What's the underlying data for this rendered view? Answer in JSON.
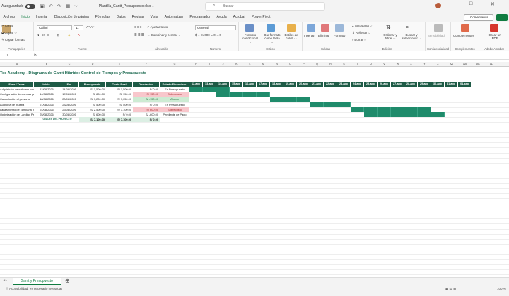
{
  "titlebar": {
    "autosave": "Autoguardado",
    "filename": "Plantilla_Gantt_Presupuesto.xlsx ⌵",
    "search_placeholder": "Buscar"
  },
  "menubar": {
    "tabs": [
      "Archivo",
      "Inicio",
      "Insertar",
      "Disposición de página",
      "Fórmulas",
      "Datos",
      "Revisar",
      "Vista",
      "Automatizar",
      "Programador",
      "Ayuda",
      "Acrobat",
      "Power Pivot"
    ],
    "active": 1,
    "comments": "Comentarios"
  },
  "ribbon": {
    "clipboard": {
      "cut": "Cortar",
      "copy": "Copiar ⌵",
      "paste_format": "Copiar formato",
      "label": "Portapapeles"
    },
    "font": {
      "name": "Calibri",
      "size": "11",
      "label": "Fuente"
    },
    "alignment": {
      "wrap": "Ajustar texto",
      "merge": "Combinar y centrar ⌵",
      "label": "Alineación"
    },
    "number": {
      "format": "General",
      "label": "Número"
    },
    "styles": {
      "cond": "Formato condicional ⌵",
      "table": "Dar formato como tabla ⌵",
      "cell": "Estilos de celda ⌵",
      "label": "Estilos"
    },
    "cells": {
      "insert": "Insertar",
      "delete": "Eliminar",
      "format": "Formato",
      "label": "Celdas"
    },
    "editing": {
      "autosum": "Autosuma ⌵",
      "fill": "Rellenar ⌵",
      "clear": "Borrar ⌵",
      "sort": "Ordenar y filtrar ⌵",
      "find": "Buscar y seleccionar ⌵",
      "label": "Edición"
    },
    "sensitivity": {
      "btn": "Sensibilidad",
      "label": "Confidencialidad"
    },
    "addins": {
      "btn": "Complementos",
      "label": "Complementos"
    },
    "pdf": {
      "btn": "Crear un PDF",
      "label": "Adobe Acrobat"
    }
  },
  "formula": {
    "namebox": "I1",
    "fx": "fx"
  },
  "columns": [
    "A",
    "B",
    "C",
    "D",
    "E",
    "F",
    "G",
    "H",
    "I",
    "J",
    "K",
    "L",
    "M",
    "N",
    "O",
    "P",
    "Q",
    "R",
    "S",
    "T",
    "U",
    "V",
    "W",
    "X",
    "Y",
    "Z",
    "AA",
    "AB",
    "AC",
    "AD"
  ],
  "sheet": {
    "title": "Tec Academy - Diagrama de Gantt Híbrido: Control de Tiempos y Presupuesto",
    "headers": [
      "Fase / Tarea",
      "Inicio",
      "Fin",
      "Presupuesto",
      "Costo Real",
      "Desviación",
      "Estado Financiero"
    ],
    "dates": [
      "12-ago",
      "13-ago",
      "14-ago",
      "15-ago",
      "16-ago",
      "17-ago",
      "18-ago",
      "19-ago",
      "20-ago",
      "21-ago",
      "22-ago",
      "23-ago",
      "24-ago",
      "25-ago",
      "26-ago",
      "27-ago",
      "28-ago",
      "29-ago",
      "30-ago",
      "31-ago",
      "01-sep"
    ],
    "rows": [
      {
        "task": "Adquisición de software contable",
        "start": "12/08/2026",
        "end": "14/08/2026",
        "budget": "S/ 1,500.00",
        "real": "S/ 1,500.00",
        "dev": "S/ 0.00",
        "status": "En Presupuesto",
        "status_type": "none"
      },
      {
        "task": "Configuración de cuentas para MYPE",
        "start": "14/08/2026",
        "end": "17/08/2026",
        "budget": "S/ 800.00",
        "real": "S/ 950.00",
        "dev": "S/ 150.00",
        "status": "Sobrecosto",
        "status_type": "red"
      },
      {
        "task": "Capacitación al personal",
        "start": "18/08/2026",
        "end": "20/08/2026",
        "budget": "S/ 1,200.00",
        "real": "S/ 1,050.00",
        "dev": "S/ -150.00",
        "status": "Ahorro",
        "status_type": "green"
      },
      {
        "task": "Auditoría de prueba",
        "start": "21/08/2026",
        "end": "23/08/2026",
        "budget": "S/ 500.00",
        "real": "S/ 500.00",
        "dev": "S/ 0.00",
        "status": "En Presupuesto",
        "status_type": "none"
      },
      {
        "task": "Lanzamiento de campaña publicitaria",
        "start": "24/08/2026",
        "end": "29/08/2026",
        "budget": "S/ 2,500.00",
        "real": "S/ 3,100.00",
        "dev": "S/ 600.00",
        "status": "Sobrecosto",
        "status_type": "red"
      },
      {
        "task": "Optimización de Landing Page",
        "start": "25/08/2026",
        "end": "30/08/2026",
        "budget": "S/ 600.00",
        "real": "S/ 0.00",
        "dev": "S/ -600.00",
        "status": "Pendiente de Pago",
        "status_type": "none"
      }
    ],
    "totals": {
      "label": "TOTALES DEL PROYECTO",
      "budget": "S/ 7,100.00",
      "real": "S/ 7,100.00",
      "dev": "S/ 0.00"
    }
  },
  "sheettabs": [
    "Gantt y Presupuesto"
  ],
  "status": {
    "accessibility": "Accesibilidad: es necesario investigar",
    "zoom": "100 %"
  },
  "colors": {
    "excel_green": "#107c41",
    "header_green": "#1e5b46",
    "bar_green": "#1f8b6b"
  }
}
